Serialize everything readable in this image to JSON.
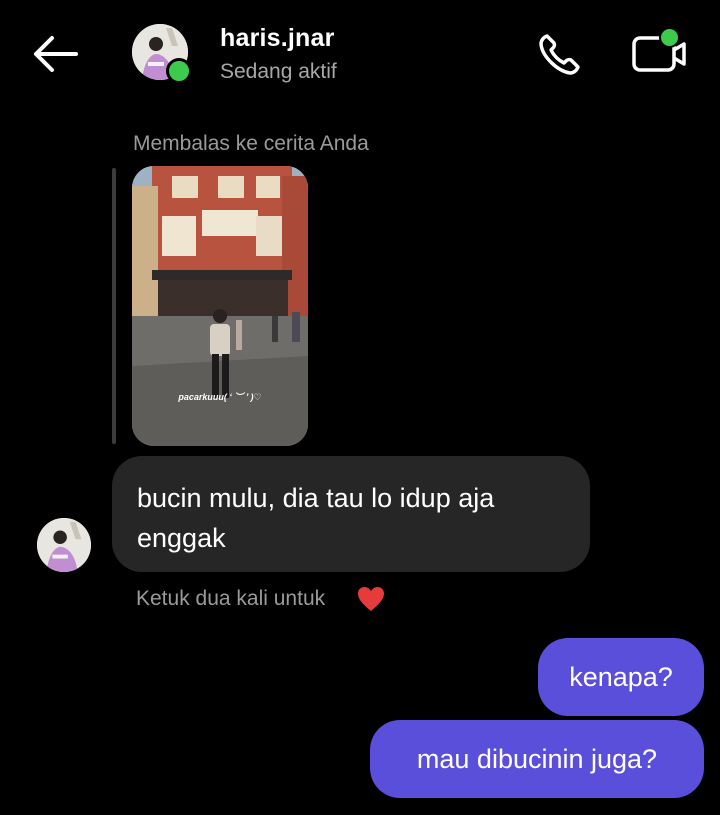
{
  "header": {
    "username": "haris.jnar",
    "status": "Sedang aktif"
  },
  "icons": {
    "back": "arrow-left-icon",
    "call": "phone-icon",
    "video": "video-call-icon"
  },
  "colors": {
    "background": "#000000",
    "incoming_bubble": "#262626",
    "outgoing_bubble": "#5a4fdb",
    "online": "#3ccb4b"
  },
  "story_reply": {
    "label": "Membalas ke cerita Anda",
    "caption": "pacarkuuu( ‘ ︶ ’ )♡"
  },
  "messages": {
    "incoming": "bucin mulu, dia tau lo idup aja enggak",
    "like_hint": "Ketuk dua kali untuk",
    "outgoing": [
      "kenapa?",
      "mau dibucinin juga?"
    ]
  }
}
